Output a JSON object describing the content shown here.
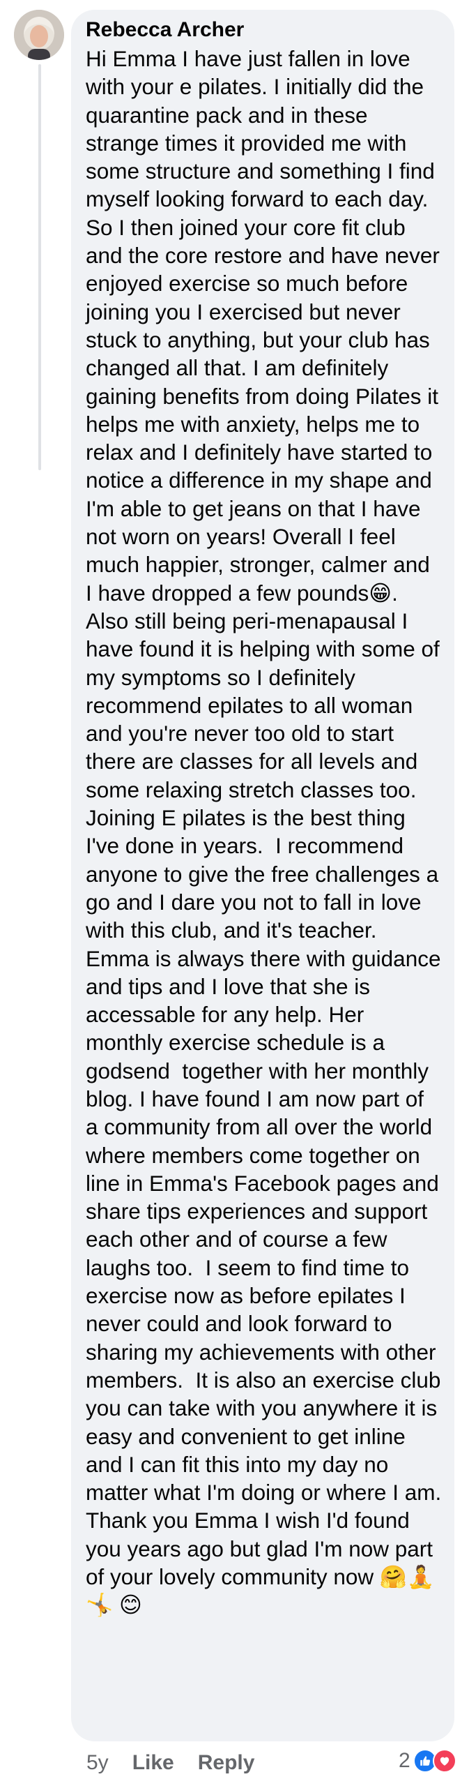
{
  "comment": {
    "author": "Rebecca Archer",
    "text": "Hi Emma I have just fallen in love with your e pilates. I initially did the quarantine pack and in these strange times it provided me with some structure and something I find myself looking forward to each day.  So I then joined your core fit club and the core restore and have never enjoyed exercise so much before joining you I exercised but never stuck to anything, but your club has changed all that. I am definitely gaining benefits from doing Pilates it helps me with anxiety, helps me to relax and I definitely have started to notice a difference in my shape and I'm able to get jeans on that I have not worn on years! Overall I feel much happier, stronger, calmer and I have dropped a few pounds😁. Also still being peri-menapausal I have found it is helping with some of my symptoms so I definitely recommend epilates to all woman and you're never too old to start there are classes for all levels and some relaxing stretch classes too. Joining E pilates is the best thing I've done in years.  I recommend anyone to give the free challenges a go and I dare you not to fall in love with this club, and it's teacher. Emma is always there with guidance and tips and I love that she is accessable for any help. Her monthly exercise schedule is a godsend  together with her monthly  blog. I have found I am now part of a community from all over the world where members come together on line in Emma's Facebook pages and share tips experiences and support each other and of course a few laughs too.  I seem to find time to exercise now as before epilates I never could and look forward to sharing my achievements with other members.  It is also an exercise club you can take with you anywhere it is easy and convenient to get inline and I can fit this into my day no matter what I'm doing or where I am.  Thank you Emma I wish I'd found you years ago but glad I'm now part of your lovely community now 🤗🧘\n🤸 😊",
    "time": "5y",
    "like_label": "Like",
    "reply_label": "Reply",
    "reaction_count": "2",
    "reactions": [
      "like-icon",
      "love-icon"
    ]
  },
  "colors": {
    "bubble": "#f0f2f5",
    "meta_text": "#65676b",
    "like_blue": "#1877f2",
    "love_red": "#f33e58"
  }
}
